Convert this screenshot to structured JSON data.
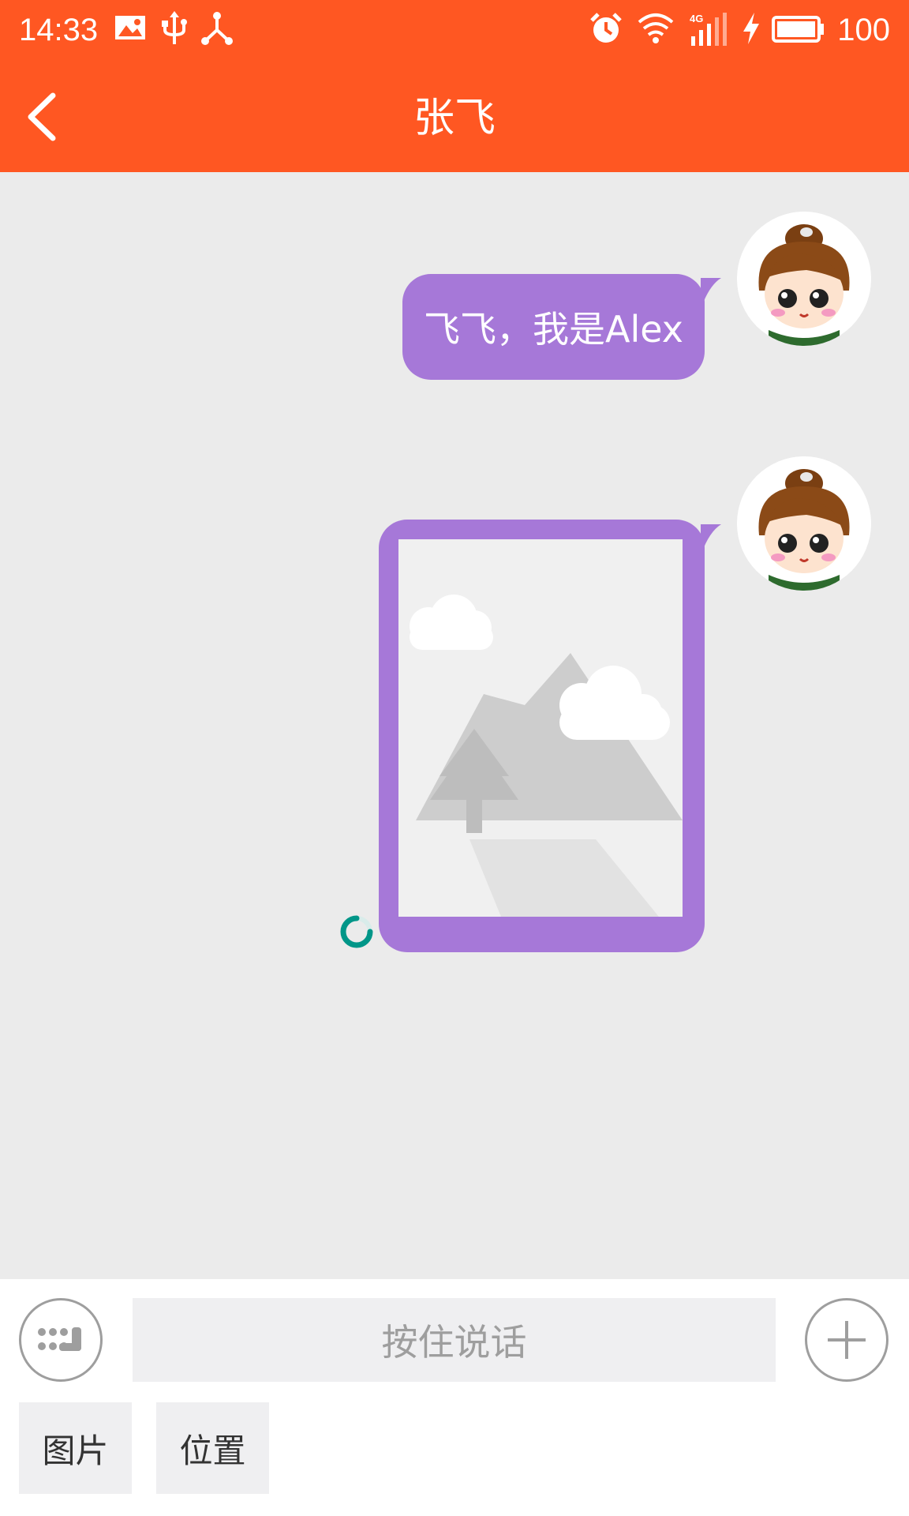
{
  "status_bar": {
    "time": "14:33",
    "network": "4G",
    "battery": "100"
  },
  "header": {
    "title": "张飞"
  },
  "messages": [
    {
      "type": "text",
      "text": "飞飞，我是Alex"
    },
    {
      "type": "image"
    }
  ],
  "input": {
    "hold_to_talk": "按住说话",
    "extensions": [
      "图片",
      "位置"
    ]
  },
  "colors": {
    "header_bg": "#ff5722",
    "bubble": "#a678d8",
    "chat_bg": "#ebebeb",
    "spinner": "#009688"
  }
}
